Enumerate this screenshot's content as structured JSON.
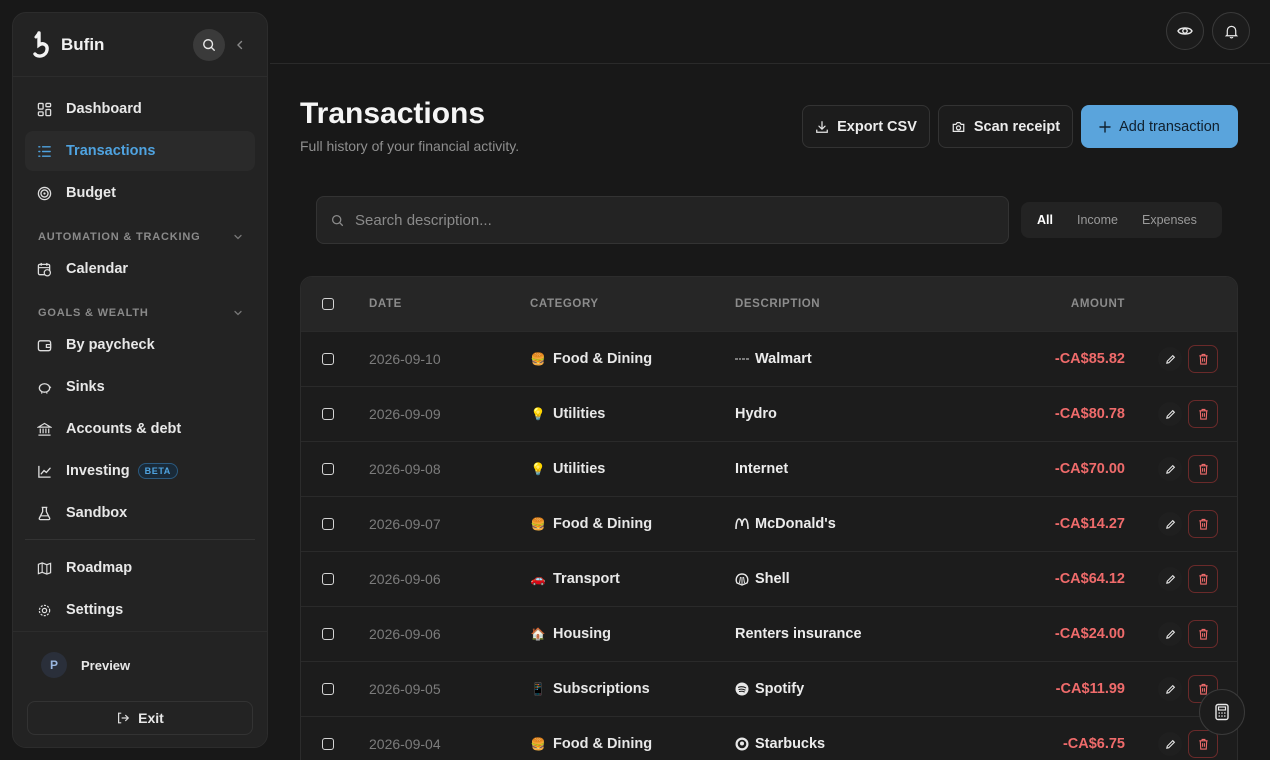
{
  "sidebar": {
    "brand": "Bufin",
    "nav": [
      {
        "label": "Dashboard",
        "icon": "dashboard-icon"
      },
      {
        "label": "Transactions",
        "icon": "list-icon",
        "active": true
      },
      {
        "label": "Budget",
        "icon": "target-icon"
      }
    ],
    "sections": [
      {
        "label": "AUTOMATION & TRACKING",
        "items": [
          {
            "label": "Calendar",
            "icon": "calendar-icon"
          }
        ]
      },
      {
        "label": "GOALS & WEALTH",
        "items": [
          {
            "label": "By paycheck",
            "icon": "wallet-icon"
          },
          {
            "label": "Sinks",
            "icon": "piggy-bank-icon"
          },
          {
            "label": "Accounts & debt",
            "icon": "bank-icon"
          },
          {
            "label": "Investing",
            "icon": "chart-line-icon",
            "badge": "BETA"
          },
          {
            "label": "Sandbox",
            "icon": "flask-icon"
          }
        ]
      }
    ],
    "extra": [
      {
        "label": "Roadmap",
        "icon": "map-icon"
      },
      {
        "label": "Settings",
        "icon": "gear-icon"
      }
    ],
    "user": {
      "initial": "P",
      "name": "Preview"
    },
    "exit_label": "Exit"
  },
  "header": {
    "title": "Transactions",
    "subtitle": "Full history of your financial activity.",
    "export_label": "Export CSV",
    "scan_label": "Scan receipt",
    "add_label": "Add transaction"
  },
  "filters": {
    "search_placeholder": "Search description...",
    "options": [
      "All",
      "Income",
      "Expenses"
    ],
    "selected": "All"
  },
  "table": {
    "columns": {
      "date": "DATE",
      "category": "CATEGORY",
      "description": "DESCRIPTION",
      "amount": "AMOUNT"
    },
    "rows": [
      {
        "date": "2026-09-10",
        "cat_emoji": "🍔",
        "category": "Food & Dining",
        "desc_icon": "walmart-icon",
        "description": "Walmart",
        "amount": "-CA$85.82"
      },
      {
        "date": "2026-09-09",
        "cat_emoji": "💡",
        "category": "Utilities",
        "desc_icon": "",
        "description": "Hydro",
        "amount": "-CA$80.78"
      },
      {
        "date": "2026-09-08",
        "cat_emoji": "💡",
        "category": "Utilities",
        "desc_icon": "",
        "description": "Internet",
        "amount": "-CA$70.00"
      },
      {
        "date": "2026-09-07",
        "cat_emoji": "🍔",
        "category": "Food & Dining",
        "desc_icon": "mcdonalds-icon",
        "description": "McDonald's",
        "amount": "-CA$14.27"
      },
      {
        "date": "2026-09-06",
        "cat_emoji": "🚗",
        "category": "Transport",
        "desc_icon": "shell-icon",
        "description": "Shell",
        "amount": "-CA$64.12"
      },
      {
        "date": "2026-09-06",
        "cat_emoji": "🏠",
        "category": "Housing",
        "desc_icon": "",
        "description": "Renters insurance",
        "amount": "-CA$24.00"
      },
      {
        "date": "2026-09-05",
        "cat_emoji": "📱",
        "category": "Subscriptions",
        "desc_icon": "spotify-icon",
        "description": "Spotify",
        "amount": "-CA$11.99"
      },
      {
        "date": "2026-09-04",
        "cat_emoji": "🍔",
        "category": "Food & Dining",
        "desc_icon": "starbucks-icon",
        "description": "Starbucks",
        "amount": "-CA$6.75"
      }
    ]
  },
  "colors": {
    "accent": "#5aa4dc",
    "active_nav": "#4fa3e0",
    "negative": "#ef6b6b"
  }
}
